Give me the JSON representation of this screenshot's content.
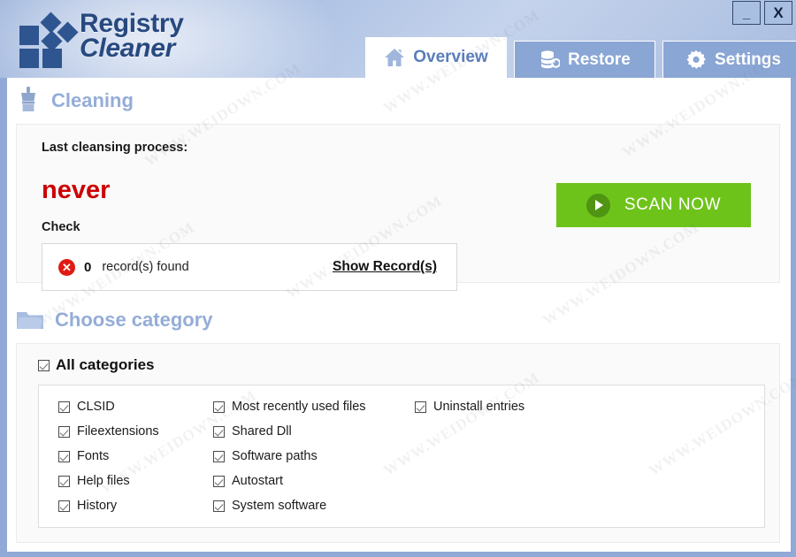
{
  "app": {
    "logo_line1": "Registry",
    "logo_line2": "Cleaner"
  },
  "window_controls": {
    "minimize_label": "_",
    "close_label": "X"
  },
  "tabs": [
    {
      "label": "Overview",
      "icon": "home-icon",
      "active": true
    },
    {
      "label": "Restore",
      "icon": "database-restore-icon",
      "active": false
    },
    {
      "label": "Settings",
      "icon": "gear-icon",
      "active": false
    }
  ],
  "cleaning": {
    "section_title": "Cleaning",
    "section_icon": "brush-icon",
    "last_process_label": "Last cleansing process:",
    "last_process_value": "never",
    "last_process_value_color": "#cc0000",
    "check_label": "Check",
    "record_status_icon": "error-circle-icon",
    "record_count": "0",
    "record_label": "record(s) found",
    "show_records_link": "Show Record(s)",
    "scan_button_label": "SCAN NOW",
    "scan_button_color": "#6ec31a",
    "scan_button_icon": "play-icon"
  },
  "category": {
    "section_title": "Choose category",
    "section_icon": "folder-icon",
    "all_label": "All categories",
    "all_checked": true,
    "columns": [
      [
        {
          "label": "CLSID",
          "checked": true
        },
        {
          "label": "Fileextensions",
          "checked": true
        },
        {
          "label": "Fonts",
          "checked": true
        },
        {
          "label": "Help files",
          "checked": true
        },
        {
          "label": "History",
          "checked": true
        }
      ],
      [
        {
          "label": "Most recently used files",
          "checked": true
        },
        {
          "label": "Shared Dll",
          "checked": true
        },
        {
          "label": "Software paths",
          "checked": true
        },
        {
          "label": "Autostart",
          "checked": true
        },
        {
          "label": "System software",
          "checked": true
        }
      ],
      [
        {
          "label": "Uninstall entries",
          "checked": true
        }
      ]
    ]
  },
  "watermark": {
    "text": "WWW.WEIDOWN.COM"
  }
}
